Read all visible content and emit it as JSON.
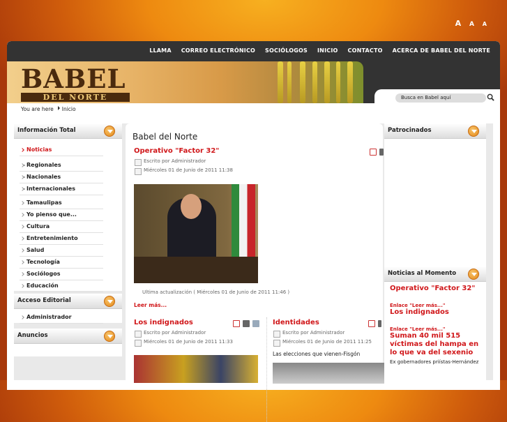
{
  "font_sizer": {
    "large": "A",
    "medium": "A",
    "small": "A"
  },
  "nav": [
    "LLAMA",
    "CORREO ELECTRÓNICO",
    "SOCIÓLOGOS",
    "INICIO",
    "CONTACTO",
    "ACERCA DE BABEL DEL NORTE"
  ],
  "logo": {
    "line1": "BABEL",
    "line2": "DEL NORTE"
  },
  "search": {
    "placeholder": "Busca en Babel aquí"
  },
  "breadcrumb": {
    "prefix": "You are here",
    "current": "Inicio"
  },
  "left": {
    "module1_title": "Información Total",
    "items": [
      {
        "label": "Noticias",
        "active": true
      },
      {
        "label": "Regionales",
        "sub": true
      },
      {
        "label": "Nacionales",
        "sub": true
      },
      {
        "label": "Internacionales",
        "sub": true
      },
      {
        "label": "Tamaulipas"
      },
      {
        "label": "Yo pienso que..."
      },
      {
        "label": "Cultura"
      },
      {
        "label": "Entretenimiento"
      },
      {
        "label": "Salud"
      },
      {
        "label": "Tecnología"
      },
      {
        "label": "Sociólogos"
      },
      {
        "label": "Educación"
      }
    ],
    "module2_title": "Acceso Editorial",
    "module2_item": "Administrador",
    "module3_title": "Anuncios"
  },
  "center": {
    "page_title": "Babel del Norte",
    "article1": {
      "title": "Operativo \"Factor 32\"",
      "author": "Escrito por Administrador",
      "date": "Miércoles 01 de Junio de 2011 11:38",
      "updated": "Ultima actualización ( Miércoles 01 de Junio de 2011 11:46 )",
      "read_more": "Leer más..."
    },
    "article2": {
      "title": "Los indignados",
      "author": "Escrito por Administrador",
      "date": "Miércoles 01 de Junio de 2011 11:33"
    },
    "article3": {
      "title": "Identidades",
      "author": "Escrito por Administrador",
      "date": "Miércoles 01 de Junio de 2011 11:25",
      "intro": "Las elecciones que vienen-Fisgón"
    }
  },
  "right": {
    "module1_title": "Patrocinados",
    "module2_title": "Noticias al Momento",
    "news": [
      {
        "link": "",
        "headline": "Operativo \"Factor 32\"",
        "text": ""
      },
      {
        "link": "Enlace \"Leer más...\"",
        "headline": "Los indignados",
        "text": ""
      },
      {
        "link": "Enlace \"Leer más...\"",
        "headline": "Suman 40 mil 515 víctimas del hampa en lo que va del sexenio",
        "text": "Ex gobernadores priístas-Hernández"
      }
    ]
  },
  "colors": {
    "accent_red": "#d0171a",
    "topbar": "#333333",
    "orange_bg": "#ee8a10"
  }
}
